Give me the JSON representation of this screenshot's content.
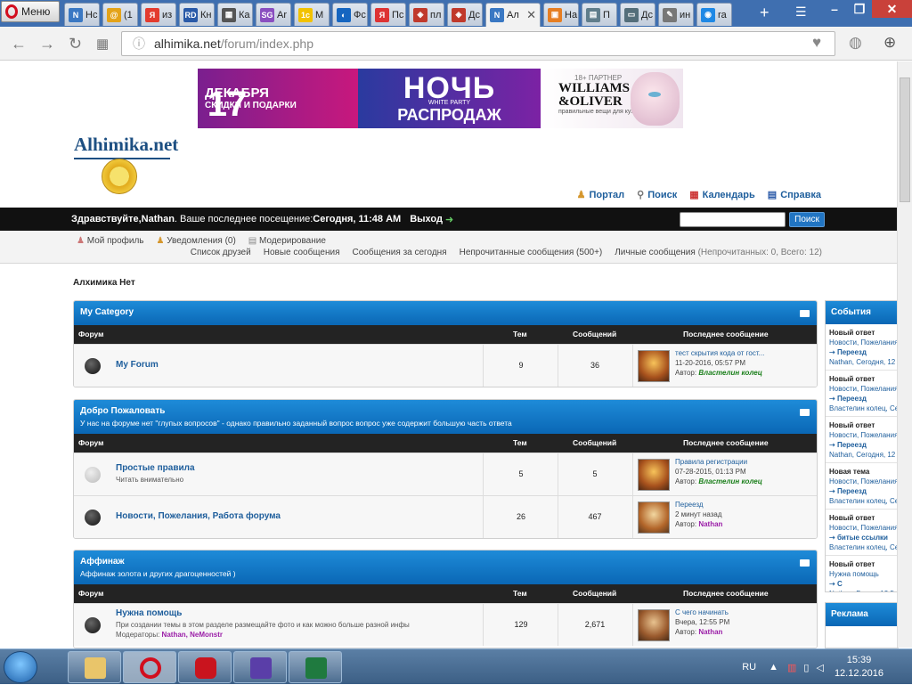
{
  "browser": {
    "menu_label": "Меню",
    "tabs": [
      {
        "label": "Нс",
        "icon": "N",
        "color": "#3a78c3"
      },
      {
        "label": "(1",
        "icon": "@",
        "color": "#e4a319"
      },
      {
        "label": "из",
        "icon": "Я",
        "color": "#e33b2e"
      },
      {
        "label": "Кн",
        "icon": "RD",
        "color": "#2a5aa8"
      },
      {
        "label": "Ка",
        "icon": "▦",
        "color": "#555"
      },
      {
        "label": "Ar",
        "icon": "SG",
        "color": "#8a4fc0"
      },
      {
        "label": "M",
        "icon": "1c",
        "color": "#f2c200"
      },
      {
        "label": "Фс",
        "icon": "◐",
        "color": "#1565c0"
      },
      {
        "label": "Пс",
        "icon": "Я",
        "color": "#d33"
      },
      {
        "label": "пл",
        "icon": "◈",
        "color": "#c0392b"
      },
      {
        "label": "Дс",
        "icon": "◈",
        "color": "#c0392b"
      },
      {
        "label": "Ал",
        "icon": "N",
        "color": "#3a78c3",
        "active": true
      },
      {
        "label": "На",
        "icon": "▣",
        "color": "#e67e22"
      },
      {
        "label": "П",
        "icon": "▤",
        "color": "#607d8b"
      },
      {
        "label": "Дс",
        "icon": "▭",
        "color": "#546e7a"
      },
      {
        "label": "ин",
        "icon": "✎",
        "color": "#777"
      },
      {
        "label": "ra",
        "icon": "◉",
        "color": "#1e88e5"
      }
    ],
    "url_host": "alhimika.net",
    "url_path": "/forum/index.php"
  },
  "banner": {
    "day": "17",
    "month": "ДЕКАБРЯ",
    "sub": "СКИДКИ И ПОДАРКИ",
    "night": "НОЧЬ",
    "white_party": "WHITE PARTY",
    "sale": "РАСПРОДАЖ",
    "age": "18+",
    "partner": "ПАРТНЕР",
    "brand1": "WILLIAMS",
    "brand2": "&OLIVER",
    "slogan": "правильные вещи для кухни"
  },
  "site": {
    "logo_text": "Alhimika.net",
    "links": [
      {
        "label": "Портал",
        "icon": "portal-icon"
      },
      {
        "label": "Поиск",
        "icon": "search-icon"
      },
      {
        "label": "Календарь",
        "icon": "calendar-icon"
      },
      {
        "label": "Справка",
        "icon": "help-icon"
      }
    ],
    "welcome_prefix": "Здравствуйте, ",
    "username": "Nathan",
    "last_visit_label": ". Ваше последнее посещение: ",
    "last_visit": "Сегодня, 11:48 AM",
    "logout": "Выход",
    "search_button": "Поиск",
    "subnav1": [
      "Мой профиль",
      "Уведомления (0)",
      "Модерирование"
    ],
    "subnav2": [
      "Список друзей",
      "Новые сообщения",
      "Сообщения за сегодня",
      "Непрочитанные сообщения (500+)"
    ],
    "pm_label": "Личные сообщения",
    "pm_counts": "(Непрочитанных: 0, Всего: 12)",
    "breadcrumb": "Алхимика Нет"
  },
  "columns": {
    "forum": "Форум",
    "topics": "Тем",
    "posts": "Сообщений",
    "last": "Последнее сообщение"
  },
  "categories": [
    {
      "title": "My Category",
      "desc": "",
      "forums": [
        {
          "name": "My Forum",
          "desc": "",
          "mods": "",
          "topics": "9",
          "posts": "36",
          "last_title": "тест скрытия кода от гост...",
          "last_date": "11-20-2016, 05:57 PM",
          "last_author_label": "Автор: ",
          "last_author": "Властелин колец",
          "author_style": "g"
        }
      ]
    },
    {
      "title": "Добро Пожаловать",
      "desc": "У нас на форуме нет \"глупых вопросов\" - однако правильно заданный вопрос вопрос уже содержит большую часть ответа",
      "forums": [
        {
          "name": "Простые правила",
          "desc": "Читать внимательно",
          "mods": "",
          "topics": "5",
          "posts": "5",
          "locked": true,
          "last_title": "Правила регистрации",
          "last_date": "07-28-2015, 01:13 PM",
          "last_author_label": "Автор: ",
          "last_author": "Властелин колец",
          "author_style": "g"
        },
        {
          "name": "Новости, Пожелания, Работа форума",
          "desc": "",
          "mods": "",
          "topics": "26",
          "posts": "467",
          "last_title": "Переезд",
          "last_date": "2 минут назад",
          "last_author_label": "Автор: ",
          "last_author": "Nathan",
          "author_style": "p"
        }
      ]
    },
    {
      "title": "Аффинаж",
      "desc": "Аффинаж золота и других драгоценностей )",
      "forums": [
        {
          "name": "Нужна помощь",
          "desc": "При создании темы в этом разделе размещайте фото и как можно больше разной инфы",
          "mods_label": "Модераторы: ",
          "mods": "Nathan, NeMonstr",
          "topics": "129",
          "posts": "2,671",
          "last_title": "С чего начинать",
          "last_date": "Вчера, 12:55 PM",
          "last_author_label": "Автор: ",
          "last_author": "Nathan",
          "author_style": "p"
        }
      ]
    }
  ],
  "sidebar": {
    "events_title": "События",
    "events": [
      {
        "head": "Новый ответ",
        "cat": "Новости, Пожелания",
        "topic": "Переезд",
        "meta": "Nathan, Сегодня, 12"
      },
      {
        "head": "Новый ответ",
        "cat": "Новости, Пожелания",
        "topic": "Переезд",
        "meta": "Властелин колец, Сег"
      },
      {
        "head": "Новый ответ",
        "cat": "Новости, Пожелания",
        "topic": "Переезд",
        "meta": "Nathan, Сегодня, 12"
      },
      {
        "head": "Новая тема",
        "cat": "Новости, Пожелания",
        "topic": "Переезд",
        "meta": "Властелин колец, Сег"
      },
      {
        "head": "Новый ответ",
        "cat": "Новости, Пожелания",
        "topic": "битые ссылки",
        "meta": "Властелин колец, Сег"
      },
      {
        "head": "Новый ответ",
        "cat": "Нужна помощь",
        "topic": "С",
        "meta": "Nathan, Вчера, 12:5"
      }
    ],
    "ads_title": "Реклама"
  },
  "taskbar": {
    "lang": "RU",
    "time": "15:39",
    "date": "12.12.2016"
  }
}
